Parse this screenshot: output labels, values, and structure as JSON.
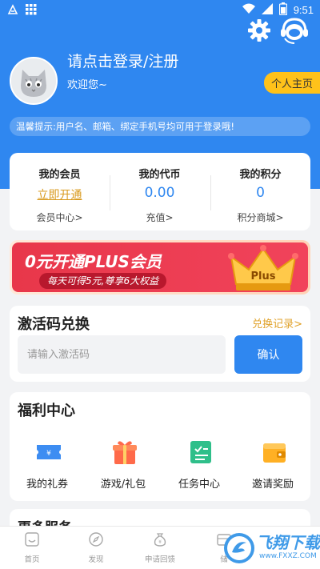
{
  "status_bar": {
    "time": "9:51",
    "icons": [
      "sim-notification-icon",
      "grid-notification-icon",
      "wifi-icon",
      "signal-icon",
      "battery-icon"
    ]
  },
  "header": {
    "settings_icon": "gear-icon",
    "service_icon": "headset-icon",
    "login_text": "请点击登录/注册",
    "welcome_text": "欢迎您~",
    "profile_button": "个人主页",
    "tip": "温馨提示:用户名、邮箱、绑定手机号均可用于登录哦!"
  },
  "stats": [
    {
      "title": "我的会员",
      "value": "立即开通",
      "sub": "会员中心>"
    },
    {
      "title": "我的代币",
      "value": "0.00",
      "sub": "充值>"
    },
    {
      "title": "我的积分",
      "value": "0",
      "sub": "积分商城>"
    }
  ],
  "banner": {
    "title": "0元开通PLUS会员",
    "subtitle": "每天可得5元,尊享6大权益",
    "crown_text": "Plus"
  },
  "activation": {
    "title": "激活码兑换",
    "history_link": "兑换记录>",
    "placeholder": "请输入激活码",
    "confirm_label": "确认"
  },
  "welfare": {
    "title": "福利中心",
    "items": [
      {
        "label": "我的礼券",
        "icon": "coupon-icon"
      },
      {
        "label": "游戏/礼包",
        "icon": "gift-box-icon"
      },
      {
        "label": "任务中心",
        "icon": "task-book-icon"
      },
      {
        "label": "邀请奖励",
        "icon": "wallet-icon"
      }
    ]
  },
  "more": {
    "title": "更多服务"
  },
  "bottom_nav": [
    {
      "label": "首页",
      "icon": "home-icon"
    },
    {
      "label": "发现",
      "icon": "compass-icon"
    },
    {
      "label": "申请回馈",
      "icon": "money-bag-icon"
    },
    {
      "label": "储",
      "icon": "chest-icon"
    }
  ],
  "watermark": {
    "text": "飞翔下载",
    "url": "www.FXXZ.COM"
  },
  "colors": {
    "primary": "#2f87f0",
    "gold": "#ffc21a",
    "banner_red": "#e8374a"
  }
}
